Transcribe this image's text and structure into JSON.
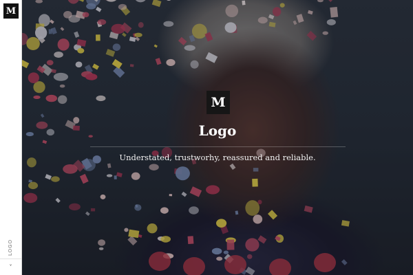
{
  "sidebar": {
    "logo_mark": "M",
    "vertical_label": "LOGO",
    "chevron": "˅"
  },
  "hero": {
    "logo_mark": "M",
    "title": "Logo",
    "tagline": "Understated, trustworhy, reassured and reliable.",
    "colors": {
      "confetti": [
        "#e8c9c8",
        "#c8506a",
        "#d8d8e0",
        "#e6d24a",
        "#7a8fb8",
        "#b93a5a",
        "#f0e6e6"
      ]
    }
  }
}
